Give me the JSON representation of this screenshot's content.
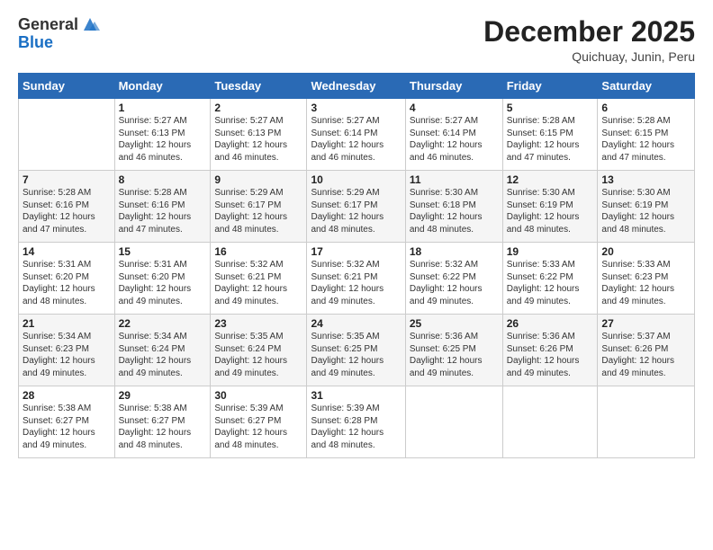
{
  "logo": {
    "general": "General",
    "blue": "Blue"
  },
  "title": "December 2025",
  "subtitle": "Quichuay, Junin, Peru",
  "days_of_week": [
    "Sunday",
    "Monday",
    "Tuesday",
    "Wednesday",
    "Thursday",
    "Friday",
    "Saturday"
  ],
  "weeks": [
    [
      {
        "day": "",
        "info": ""
      },
      {
        "day": "1",
        "info": "Sunrise: 5:27 AM\nSunset: 6:13 PM\nDaylight: 12 hours\nand 46 minutes."
      },
      {
        "day": "2",
        "info": "Sunrise: 5:27 AM\nSunset: 6:13 PM\nDaylight: 12 hours\nand 46 minutes."
      },
      {
        "day": "3",
        "info": "Sunrise: 5:27 AM\nSunset: 6:14 PM\nDaylight: 12 hours\nand 46 minutes."
      },
      {
        "day": "4",
        "info": "Sunrise: 5:27 AM\nSunset: 6:14 PM\nDaylight: 12 hours\nand 46 minutes."
      },
      {
        "day": "5",
        "info": "Sunrise: 5:28 AM\nSunset: 6:15 PM\nDaylight: 12 hours\nand 47 minutes."
      },
      {
        "day": "6",
        "info": "Sunrise: 5:28 AM\nSunset: 6:15 PM\nDaylight: 12 hours\nand 47 minutes."
      }
    ],
    [
      {
        "day": "7",
        "info": "Sunrise: 5:28 AM\nSunset: 6:16 PM\nDaylight: 12 hours\nand 47 minutes."
      },
      {
        "day": "8",
        "info": "Sunrise: 5:28 AM\nSunset: 6:16 PM\nDaylight: 12 hours\nand 47 minutes."
      },
      {
        "day": "9",
        "info": "Sunrise: 5:29 AM\nSunset: 6:17 PM\nDaylight: 12 hours\nand 48 minutes."
      },
      {
        "day": "10",
        "info": "Sunrise: 5:29 AM\nSunset: 6:17 PM\nDaylight: 12 hours\nand 48 minutes."
      },
      {
        "day": "11",
        "info": "Sunrise: 5:30 AM\nSunset: 6:18 PM\nDaylight: 12 hours\nand 48 minutes."
      },
      {
        "day": "12",
        "info": "Sunrise: 5:30 AM\nSunset: 6:19 PM\nDaylight: 12 hours\nand 48 minutes."
      },
      {
        "day": "13",
        "info": "Sunrise: 5:30 AM\nSunset: 6:19 PM\nDaylight: 12 hours\nand 48 minutes."
      }
    ],
    [
      {
        "day": "14",
        "info": "Sunrise: 5:31 AM\nSunset: 6:20 PM\nDaylight: 12 hours\nand 48 minutes."
      },
      {
        "day": "15",
        "info": "Sunrise: 5:31 AM\nSunset: 6:20 PM\nDaylight: 12 hours\nand 49 minutes."
      },
      {
        "day": "16",
        "info": "Sunrise: 5:32 AM\nSunset: 6:21 PM\nDaylight: 12 hours\nand 49 minutes."
      },
      {
        "day": "17",
        "info": "Sunrise: 5:32 AM\nSunset: 6:21 PM\nDaylight: 12 hours\nand 49 minutes."
      },
      {
        "day": "18",
        "info": "Sunrise: 5:32 AM\nSunset: 6:22 PM\nDaylight: 12 hours\nand 49 minutes."
      },
      {
        "day": "19",
        "info": "Sunrise: 5:33 AM\nSunset: 6:22 PM\nDaylight: 12 hours\nand 49 minutes."
      },
      {
        "day": "20",
        "info": "Sunrise: 5:33 AM\nSunset: 6:23 PM\nDaylight: 12 hours\nand 49 minutes."
      }
    ],
    [
      {
        "day": "21",
        "info": "Sunrise: 5:34 AM\nSunset: 6:23 PM\nDaylight: 12 hours\nand 49 minutes."
      },
      {
        "day": "22",
        "info": "Sunrise: 5:34 AM\nSunset: 6:24 PM\nDaylight: 12 hours\nand 49 minutes."
      },
      {
        "day": "23",
        "info": "Sunrise: 5:35 AM\nSunset: 6:24 PM\nDaylight: 12 hours\nand 49 minutes."
      },
      {
        "day": "24",
        "info": "Sunrise: 5:35 AM\nSunset: 6:25 PM\nDaylight: 12 hours\nand 49 minutes."
      },
      {
        "day": "25",
        "info": "Sunrise: 5:36 AM\nSunset: 6:25 PM\nDaylight: 12 hours\nand 49 minutes."
      },
      {
        "day": "26",
        "info": "Sunrise: 5:36 AM\nSunset: 6:26 PM\nDaylight: 12 hours\nand 49 minutes."
      },
      {
        "day": "27",
        "info": "Sunrise: 5:37 AM\nSunset: 6:26 PM\nDaylight: 12 hours\nand 49 minutes."
      }
    ],
    [
      {
        "day": "28",
        "info": "Sunrise: 5:38 AM\nSunset: 6:27 PM\nDaylight: 12 hours\nand 49 minutes."
      },
      {
        "day": "29",
        "info": "Sunrise: 5:38 AM\nSunset: 6:27 PM\nDaylight: 12 hours\nand 48 minutes."
      },
      {
        "day": "30",
        "info": "Sunrise: 5:39 AM\nSunset: 6:27 PM\nDaylight: 12 hours\nand 48 minutes."
      },
      {
        "day": "31",
        "info": "Sunrise: 5:39 AM\nSunset: 6:28 PM\nDaylight: 12 hours\nand 48 minutes."
      },
      {
        "day": "",
        "info": ""
      },
      {
        "day": "",
        "info": ""
      },
      {
        "day": "",
        "info": ""
      }
    ]
  ]
}
